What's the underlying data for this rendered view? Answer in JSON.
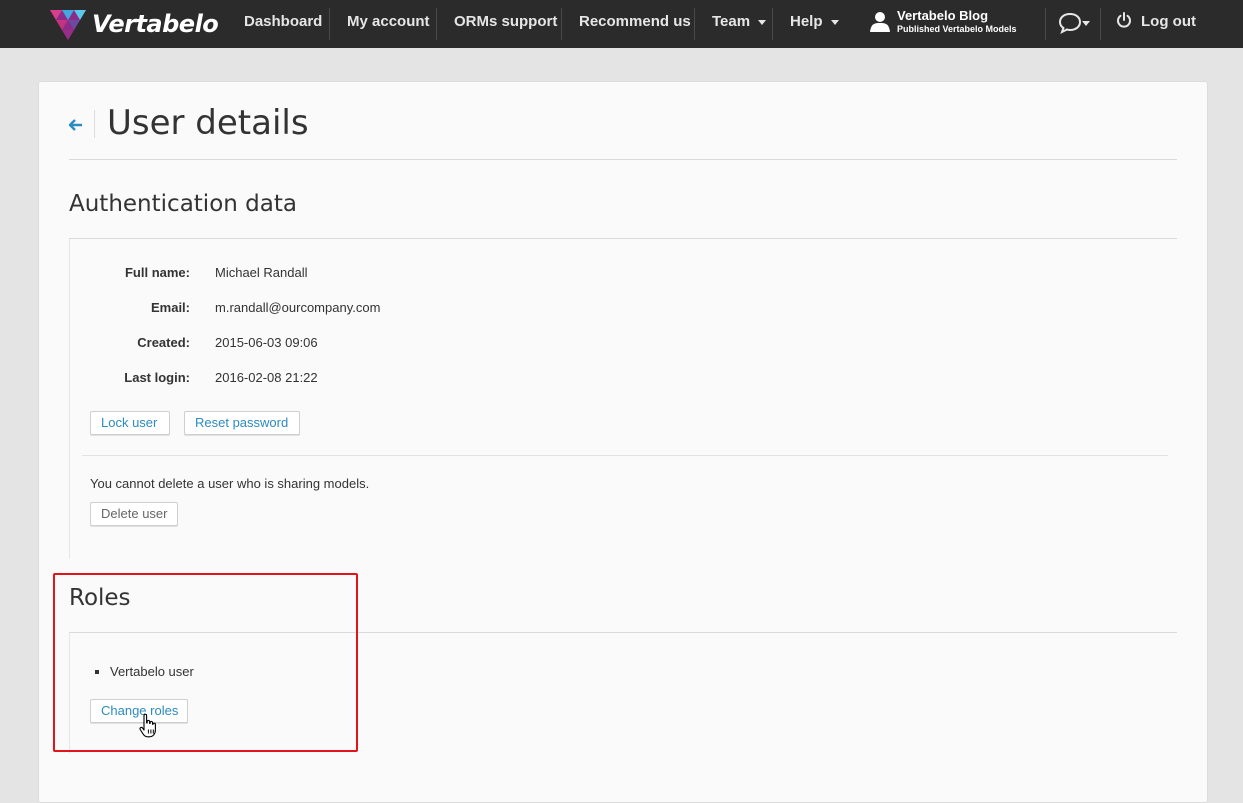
{
  "app": {
    "name": "Vertabelo"
  },
  "nav": {
    "items": [
      {
        "label": "Dashboard"
      },
      {
        "label": "My account"
      },
      {
        "label": "ORMs support"
      },
      {
        "label": "Recommend us"
      },
      {
        "label": "Team"
      },
      {
        "label": "Help"
      }
    ],
    "blog": {
      "title": "Vertabelo Blog",
      "subtitle": "Published Vertabelo Models"
    },
    "logout": "Log out"
  },
  "page": {
    "title": "User details"
  },
  "auth": {
    "heading": "Authentication data",
    "fields": [
      {
        "label": "Full name:",
        "value": "Michael Randall"
      },
      {
        "label": "Email:",
        "value": "m.randall@ourcompany.com"
      },
      {
        "label": "Created:",
        "value": "2015-06-03 09:06"
      },
      {
        "label": "Last login:",
        "value": "2016-02-08 21:22"
      }
    ],
    "lock_button": "Lock user",
    "reset_button": "Reset password",
    "delete_note": "You cannot delete a user who is sharing models.",
    "delete_button": "Delete user"
  },
  "roles": {
    "heading": "Roles",
    "items": [
      "Vertabelo user"
    ],
    "change_button": "Change roles"
  },
  "colors": {
    "accent": "#2b8bc2",
    "topbar": "#2b2b2b",
    "highlight": "#e1131b"
  }
}
